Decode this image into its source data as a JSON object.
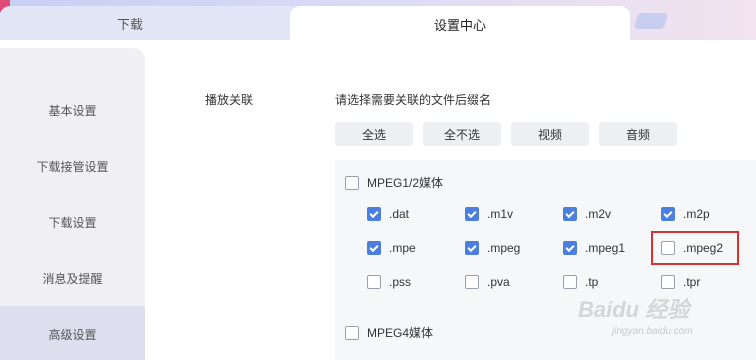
{
  "tabs": {
    "left_label": "下载",
    "active_label": "设置中心"
  },
  "sidebar": {
    "items": [
      {
        "label": "基本设置",
        "active": false
      },
      {
        "label": "下载接管设置",
        "active": false
      },
      {
        "label": "下载设置",
        "active": false
      },
      {
        "label": "消息及提醒",
        "active": false
      },
      {
        "label": "高级设置",
        "active": true
      }
    ]
  },
  "content": {
    "section_label": "播放关联",
    "hint": "请选择需要关联的文件后缀名",
    "buttons": {
      "select_all": "全选",
      "select_none": "全不选",
      "video": "视频",
      "audio": "音频"
    },
    "groups": [
      {
        "label": "MPEG1/2媒体",
        "checked": false,
        "items": [
          {
            "label": ".dat",
            "checked": true
          },
          {
            "label": ".m1v",
            "checked": true
          },
          {
            "label": ".m2v",
            "checked": true
          },
          {
            "label": ".m2p",
            "checked": true
          },
          {
            "label": ".mpe",
            "checked": true
          },
          {
            "label": ".mpeg",
            "checked": true
          },
          {
            "label": ".mpeg1",
            "checked": true
          },
          {
            "label": ".mpeg2",
            "checked": false
          },
          {
            "label": ".pss",
            "checked": false
          },
          {
            "label": ".pva",
            "checked": false
          },
          {
            "label": ".tp",
            "checked": false
          },
          {
            "label": ".tpr",
            "checked": false
          }
        ]
      },
      {
        "label": "MPEG4媒体",
        "checked": false
      }
    ]
  },
  "watermark": {
    "brand": "Baidu 经验",
    "url": "jingyan.baidu.com"
  },
  "colors": {
    "accent": "#4a7fe0",
    "highlight": "#d93030"
  }
}
